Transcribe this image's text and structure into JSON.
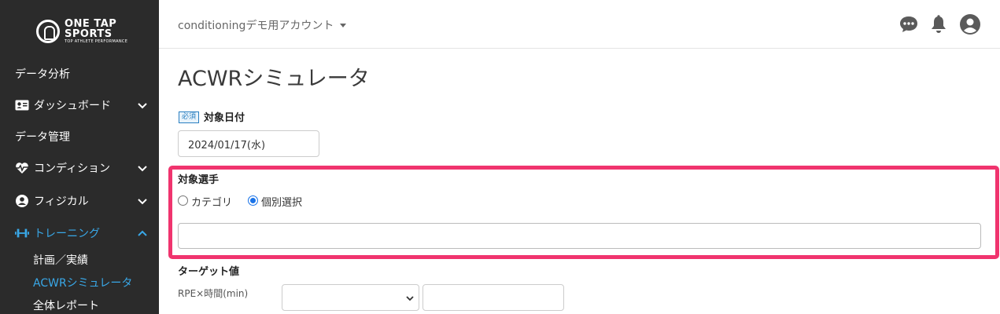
{
  "brand": {
    "line1": "ONE TAP",
    "line2": "SPORTS",
    "tagline": "TOP ATHLETE PERFORMANCE"
  },
  "sidebar": {
    "items": [
      {
        "label": "データ分析",
        "icon": "",
        "expandable": false
      },
      {
        "label": "ダッシュボード",
        "icon": "id-card-icon",
        "expandable": true,
        "expanded": false
      },
      {
        "label": "データ管理",
        "icon": "",
        "expandable": false
      },
      {
        "label": "コンディション",
        "icon": "heartbeat-icon",
        "expandable": true,
        "expanded": false
      },
      {
        "label": "フィジカル",
        "icon": "user-circle-icon",
        "expandable": true,
        "expanded": false
      },
      {
        "label": "トレーニング",
        "icon": "dumbbell-icon",
        "expandable": true,
        "expanded": true,
        "active": true
      }
    ],
    "subitems": [
      {
        "label": "計画／実績",
        "active": false
      },
      {
        "label": "ACWRシミュレータ",
        "active": true
      },
      {
        "label": "全体レポート",
        "active": false
      }
    ]
  },
  "header": {
    "account": "conditioningデモ用アカウント",
    "icons": [
      "chat-icon",
      "bell-icon",
      "user-avatar-icon"
    ]
  },
  "main": {
    "title": "ACWRシミュレータ",
    "required_badge": "必須",
    "date_label": "対象日付",
    "date_value": "2024/01/17(水)",
    "player_label": "対象選手",
    "radio_category": "カテゴリ",
    "radio_individual": "個別選択",
    "selected_mode": "個別選択",
    "player_input_value": "",
    "target_label": "ターゲット値",
    "rpe_label": "RPE×時間(min)",
    "rpe_select_value": "",
    "rpe_input_value": ""
  },
  "colors": {
    "sidebar_bg": "#2b2b2b",
    "accent": "#39a8e8",
    "highlight": "#f0346e",
    "radio_selected": "#1a73e8"
  }
}
